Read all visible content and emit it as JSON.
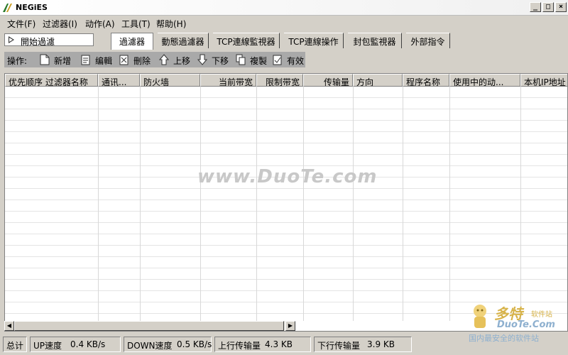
{
  "window": {
    "title": "NEGiES"
  },
  "window_buttons": {
    "minimize": "_",
    "maximize": "□",
    "close": "×"
  },
  "menu": [
    "文件(F)",
    "过滤器(I)",
    "动作(A)",
    "工具(T)",
    "帮助(H)"
  ],
  "start_button": {
    "label": "開始過濾"
  },
  "tabs": [
    "過濾器",
    "動態過濾器",
    "TCP連線監視器",
    "TCP連線操作",
    "封包監視器",
    "外部指令"
  ],
  "operations": {
    "label": "操作:",
    "items": [
      "新增",
      "编輯",
      "刪除",
      "上移",
      "下移",
      "複製",
      "有效"
    ]
  },
  "table": {
    "columns": [
      "优先顺序 过滤器名称",
      "通讯...",
      "防火墙",
      "当前带宽",
      "限制带宽",
      "传输量",
      "方向",
      "程序名称",
      "使用中的动...",
      "本机IP地址"
    ],
    "rows": []
  },
  "watermark_text": "www.DuoTe.com",
  "status": {
    "total_label": "总计",
    "up_label": "UP速度",
    "up_value": "0.4 KB/s",
    "down_label": "DOWN速度",
    "down_value": "0.5 KB/s",
    "upload_label": "上行传输量",
    "upload_value": "4.3 KB",
    "download_label": "下行传输量",
    "download_value": "3.9 KB"
  },
  "logo": {
    "name": "多特",
    "tag": "软件站",
    "site": "DuoTe.Com",
    "slogan": "国内最安全的软件站"
  }
}
